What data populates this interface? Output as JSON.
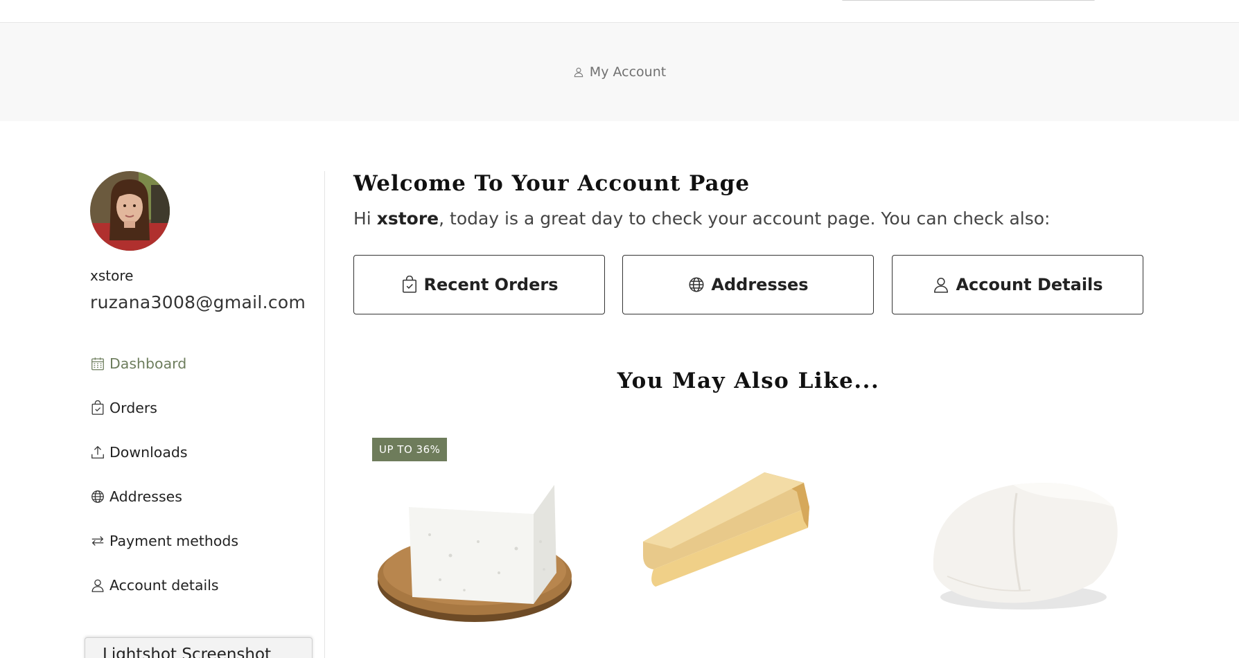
{
  "breadcrumb": {
    "label": "My Account",
    "icon": "user-icon"
  },
  "user": {
    "username": "xstore",
    "email": "ruzana3008@gmail.com"
  },
  "nav": {
    "items": [
      {
        "label": "Dashboard",
        "icon": "calendar-icon",
        "active": true
      },
      {
        "label": "Orders",
        "icon": "shopping-bag-icon"
      },
      {
        "label": "Downloads",
        "icon": "upload-icon"
      },
      {
        "label": "Addresses",
        "icon": "globe-icon"
      },
      {
        "label": "Payment methods",
        "icon": "swap-arrows-icon"
      },
      {
        "label": "Account details",
        "icon": "user-icon"
      }
    ]
  },
  "welcome": {
    "title": "Welcome To Your Account Page",
    "intro_prefix": "Hi ",
    "intro_name": "xstore",
    "intro_suffix": ", today is a great day to check your account page. You can check also:"
  },
  "quick_links": [
    {
      "label": "Recent Orders",
      "icon": "shopping-bag-icon"
    },
    {
      "label": "Addresses",
      "icon": "globe-icon"
    },
    {
      "label": "Account Details",
      "icon": "user-icon"
    }
  ],
  "recommendations": {
    "title": "You May Also Like...",
    "products": [
      {
        "image": "feta-cheese-image",
        "badge": "UP TO 36%"
      },
      {
        "image": "parmesan-wedge-image"
      },
      {
        "image": "mozzarella-image"
      }
    ]
  },
  "overlay": {
    "label": "Lightshot Screenshot"
  },
  "colors": {
    "accent": "#6d7d5d",
    "badge_bg": "#6e7c5b",
    "hero_bg": "#f8f8f8"
  }
}
